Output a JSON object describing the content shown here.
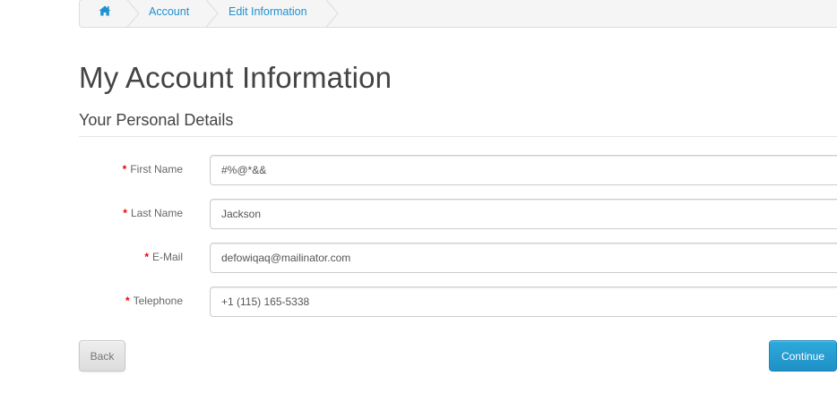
{
  "breadcrumb": {
    "home_icon": "home-icon",
    "items": [
      "Account",
      "Edit Information"
    ]
  },
  "page": {
    "title": "My Account Information",
    "legend": "Your Personal Details"
  },
  "form": {
    "required_marker": "*",
    "fields": [
      {
        "label": "First Name",
        "value": "#%@*&&"
      },
      {
        "label": "Last Name",
        "value": "Jackson"
      },
      {
        "label": "E-Mail",
        "value": "defowiqaq@mailinator.com"
      },
      {
        "label": "Telephone",
        "value": "+1 (115) 165-5338"
      }
    ]
  },
  "buttons": {
    "back": "Back",
    "continue": "Continue"
  },
  "colors": {
    "link": "#1e91cf",
    "required": "#f00000",
    "primary_button": "#229ac8"
  }
}
